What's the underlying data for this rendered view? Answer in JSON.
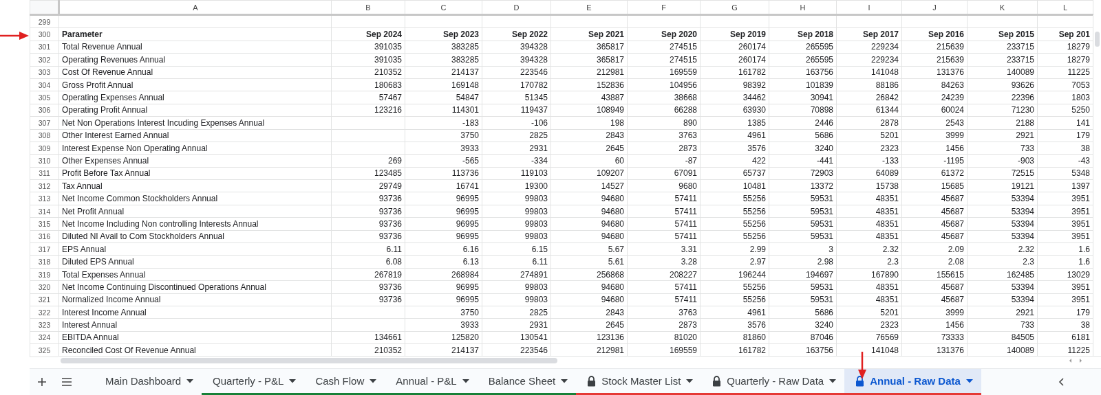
{
  "sheet": {
    "columns": [
      "A",
      "B",
      "C",
      "D",
      "E",
      "F",
      "G",
      "H",
      "I",
      "J",
      "K",
      "L"
    ],
    "rows": [
      {
        "number": "299",
        "kind": "blank"
      },
      {
        "number": "300",
        "kind": "header",
        "cells": [
          "Parameter",
          "Sep 2024",
          "Sep 2023",
          "Sep 2022",
          "Sep 2021",
          "Sep 2020",
          "Sep 2019",
          "Sep 2018",
          "Sep 2017",
          "Sep 2016",
          "Sep 2015",
          "Sep 201"
        ]
      },
      {
        "number": "301",
        "kind": "data",
        "cells": [
          "Total Revenue Annual",
          "391035",
          "383285",
          "394328",
          "365817",
          "274515",
          "260174",
          "265595",
          "229234",
          "215639",
          "233715",
          "18279"
        ]
      },
      {
        "number": "302",
        "kind": "data",
        "cells": [
          "Operating Revenues Annual",
          "391035",
          "383285",
          "394328",
          "365817",
          "274515",
          "260174",
          "265595",
          "229234",
          "215639",
          "233715",
          "18279"
        ]
      },
      {
        "number": "303",
        "kind": "data",
        "cells": [
          "Cost Of Revenue Annual",
          "210352",
          "214137",
          "223546",
          "212981",
          "169559",
          "161782",
          "163756",
          "141048",
          "131376",
          "140089",
          "11225"
        ]
      },
      {
        "number": "304",
        "kind": "data",
        "cells": [
          "Gross Profit Annual",
          "180683",
          "169148",
          "170782",
          "152836",
          "104956",
          "98392",
          "101839",
          "88186",
          "84263",
          "93626",
          "7053"
        ]
      },
      {
        "number": "305",
        "kind": "data",
        "cells": [
          "Operating Expenses Annual",
          "57467",
          "54847",
          "51345",
          "43887",
          "38668",
          "34462",
          "30941",
          "26842",
          "24239",
          "22396",
          "1803"
        ]
      },
      {
        "number": "306",
        "kind": "data",
        "cells": [
          "Operating Profit Annual",
          "123216",
          "114301",
          "119437",
          "108949",
          "66288",
          "63930",
          "70898",
          "61344",
          "60024",
          "71230",
          "5250"
        ]
      },
      {
        "number": "307",
        "kind": "data",
        "cells": [
          "Net Non Operations Interest Incuding Expenses Annual",
          null,
          "-183",
          "-106",
          "198",
          "890",
          "1385",
          "2446",
          "2878",
          "2543",
          "2188",
          "141"
        ]
      },
      {
        "number": "308",
        "kind": "data",
        "cells": [
          "Other Interest Earned Annual",
          null,
          "3750",
          "2825",
          "2843",
          "3763",
          "4961",
          "5686",
          "5201",
          "3999",
          "2921",
          "179"
        ]
      },
      {
        "number": "309",
        "kind": "data",
        "cells": [
          "Interest Expense Non Operating Annual",
          null,
          "3933",
          "2931",
          "2645",
          "2873",
          "3576",
          "3240",
          "2323",
          "1456",
          "733",
          "38"
        ]
      },
      {
        "number": "310",
        "kind": "data",
        "cells": [
          "Other Expenses Annual",
          "269",
          "-565",
          "-334",
          "60",
          "-87",
          "422",
          "-441",
          "-133",
          "-1195",
          "-903",
          "-43"
        ]
      },
      {
        "number": "311",
        "kind": "data",
        "cells": [
          "Profit Before Tax Annual",
          "123485",
          "113736",
          "119103",
          "109207",
          "67091",
          "65737",
          "72903",
          "64089",
          "61372",
          "72515",
          "5348"
        ]
      },
      {
        "number": "312",
        "kind": "data",
        "cells": [
          "Tax Annual",
          "29749",
          "16741",
          "19300",
          "14527",
          "9680",
          "10481",
          "13372",
          "15738",
          "15685",
          "19121",
          "1397"
        ]
      },
      {
        "number": "313",
        "kind": "data",
        "cells": [
          "Net Income Common Stockholders Annual",
          "93736",
          "96995",
          "99803",
          "94680",
          "57411",
          "55256",
          "59531",
          "48351",
          "45687",
          "53394",
          "3951"
        ]
      },
      {
        "number": "314",
        "kind": "data",
        "cells": [
          "Net Profit Annual",
          "93736",
          "96995",
          "99803",
          "94680",
          "57411",
          "55256",
          "59531",
          "48351",
          "45687",
          "53394",
          "3951"
        ]
      },
      {
        "number": "315",
        "kind": "data",
        "cells": [
          "Net Income Including Non controlling Interests Annual",
          "93736",
          "96995",
          "99803",
          "94680",
          "57411",
          "55256",
          "59531",
          "48351",
          "45687",
          "53394",
          "3951"
        ]
      },
      {
        "number": "316",
        "kind": "data",
        "cells": [
          "Diluted NI Avail to Com Stockholders Annual",
          "93736",
          "96995",
          "99803",
          "94680",
          "57411",
          "55256",
          "59531",
          "48351",
          "45687",
          "53394",
          "3951"
        ]
      },
      {
        "number": "317",
        "kind": "data",
        "cells": [
          "EPS Annual",
          "6.11",
          "6.16",
          "6.15",
          "5.67",
          "3.31",
          "2.99",
          "3",
          "2.32",
          "2.09",
          "2.32",
          "1.6"
        ]
      },
      {
        "number": "318",
        "kind": "data",
        "cells": [
          "Diluted EPS Annual",
          "6.08",
          "6.13",
          "6.11",
          "5.61",
          "3.28",
          "2.97",
          "2.98",
          "2.3",
          "2.08",
          "2.3",
          "1.6"
        ]
      },
      {
        "number": "319",
        "kind": "data",
        "cells": [
          "Total Expenses Annual",
          "267819",
          "268984",
          "274891",
          "256868",
          "208227",
          "196244",
          "194697",
          "167890",
          "155615",
          "162485",
          "13029"
        ]
      },
      {
        "number": "320",
        "kind": "data",
        "cells": [
          "Net Income Continuing Discontinued Operations Annual",
          "93736",
          "96995",
          "99803",
          "94680",
          "57411",
          "55256",
          "59531",
          "48351",
          "45687",
          "53394",
          "3951"
        ]
      },
      {
        "number": "321",
        "kind": "data",
        "cells": [
          "Normalized Income Annual",
          "93736",
          "96995",
          "99803",
          "94680",
          "57411",
          "55256",
          "59531",
          "48351",
          "45687",
          "53394",
          "3951"
        ]
      },
      {
        "number": "322",
        "kind": "data",
        "cells": [
          "Interest Income Annual",
          null,
          "3750",
          "2825",
          "2843",
          "3763",
          "4961",
          "5686",
          "5201",
          "3999",
          "2921",
          "179"
        ]
      },
      {
        "number": "323",
        "kind": "data",
        "cells": [
          "Interest Annual",
          null,
          "3933",
          "2931",
          "2645",
          "2873",
          "3576",
          "3240",
          "2323",
          "1456",
          "733",
          "38"
        ]
      },
      {
        "number": "324",
        "kind": "data",
        "cells": [
          "EBITDA Annual",
          "134661",
          "125820",
          "130541",
          "123136",
          "81020",
          "81860",
          "87046",
          "76569",
          "73333",
          "84505",
          "6181"
        ]
      },
      {
        "number": "325",
        "kind": "data",
        "cells": [
          "Reconciled Cost Of Revenue Annual",
          "210352",
          "214137",
          "223546",
          "212981",
          "169559",
          "161782",
          "163756",
          "141048",
          "131376",
          "140089",
          "11225"
        ]
      }
    ]
  },
  "tabs": [
    {
      "label": "Main Dashboard",
      "locked": false,
      "selected": false
    },
    {
      "label": "Quarterly - P&L",
      "locked": false,
      "selected": false,
      "color": "#188038"
    },
    {
      "label": "Cash Flow",
      "locked": false,
      "selected": false,
      "color": "#188038"
    },
    {
      "label": "Annual - P&L",
      "locked": false,
      "selected": false,
      "color": "#188038"
    },
    {
      "label": "Balance Sheet",
      "locked": false,
      "selected": false,
      "color": "#188038"
    },
    {
      "label": "Stock Master List",
      "locked": true,
      "selected": false,
      "color": "#e53935"
    },
    {
      "label": "Quarterly - Raw Data",
      "locked": true,
      "selected": false,
      "color": "#e53935"
    },
    {
      "label": "Annual - Raw Data",
      "locked": true,
      "selected": true,
      "color": "#e53935"
    }
  ]
}
